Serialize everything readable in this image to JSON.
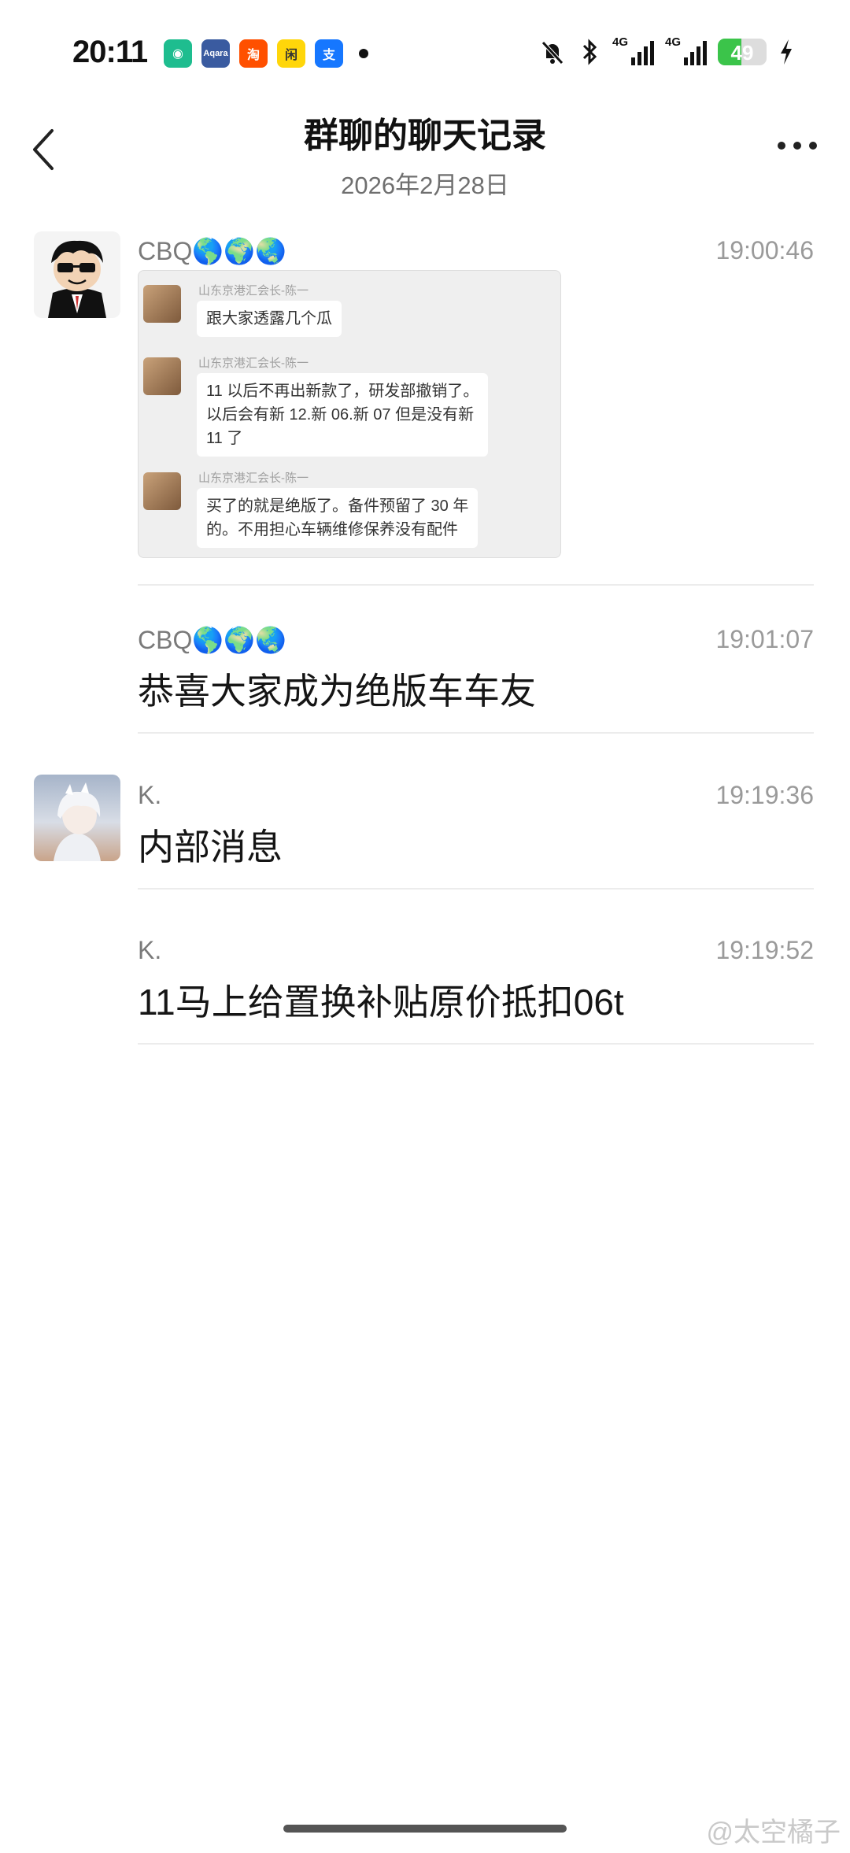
{
  "status_bar": {
    "time": "20:11",
    "network_1": "4G",
    "network_2": "4G",
    "battery": "49",
    "battery_level": 0.49,
    "app_icons": [
      {
        "name": "mijia-icon",
        "color": "#1ebd8f",
        "glyph": "◉"
      },
      {
        "name": "aqara-icon",
        "color": "#3a5ba0",
        "glyph": "Aqara"
      },
      {
        "name": "taobao-icon",
        "color": "#ff5000",
        "glyph": "淘"
      },
      {
        "name": "xianyu-icon",
        "color": "#ffd60a",
        "glyph": "闲"
      },
      {
        "name": "alipay-icon",
        "color": "#1677ff",
        "glyph": "支"
      }
    ]
  },
  "header": {
    "title": "群聊的聊天记录",
    "date": "2026年2月28日"
  },
  "messages": [
    {
      "sender": "CBQ🌎🌍🌏",
      "time": "19:00:46",
      "embedded": {
        "items": [
          {
            "name": "山东京港汇会长-陈一",
            "text_lines": [
              "跟大家透露几个瓜"
            ]
          },
          {
            "name": "山东京港汇会长-陈一",
            "text_lines": [
              "11 以后不再出新款了，研发部撤销了。",
              "以后会有新 12.新 06.新 07 但是没有新",
              "11 了"
            ]
          },
          {
            "name": "山东京港汇会长-陈一",
            "text_lines": [
              "买了的就是绝版了。备件预留了 30 年",
              "的。不用担心车辆维修保养没有配件"
            ]
          }
        ]
      }
    },
    {
      "sender": "CBQ🌎🌍🌏",
      "time": "19:01:07",
      "text": "恭喜大家成为绝版车车友"
    },
    {
      "sender": "K.",
      "time": "19:19:36",
      "text": "内部消息"
    },
    {
      "sender": "K.",
      "time": "19:19:52",
      "text": "11马上给置换补贴原价抵扣06t"
    }
  ],
  "watermark": "@太空橘子"
}
